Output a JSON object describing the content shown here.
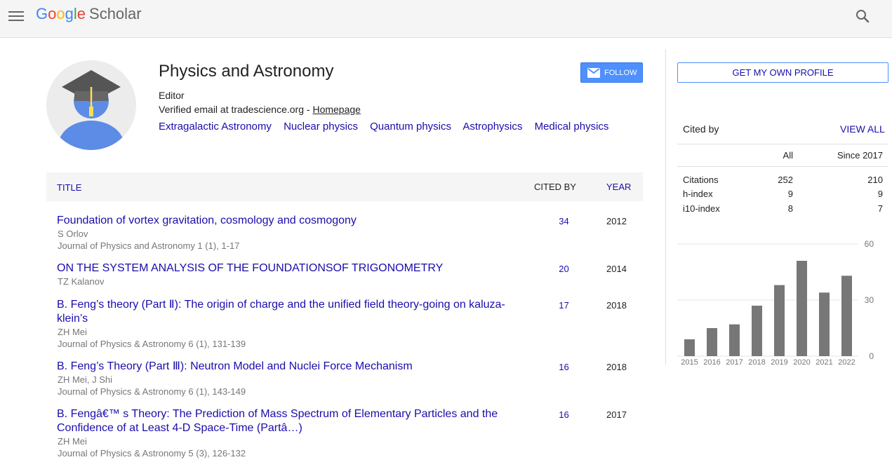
{
  "header": {
    "logo_letters": [
      "G",
      "o",
      "o",
      "g",
      "l",
      "e"
    ],
    "logo_suffix": "Scholar"
  },
  "profile": {
    "name": "Physics and Astronomy",
    "affiliation": "Editor",
    "email_text": "Verified email at tradescience.org - ",
    "homepage_label": "Homepage",
    "interests": [
      "Extragalactic Astronomy",
      "Nuclear physics",
      "Quantum physics",
      "Astrophysics",
      "Medical physics"
    ],
    "follow_label": "FOLLOW"
  },
  "table": {
    "headers": {
      "title": "TITLE",
      "cited_by": "CITED BY",
      "year": "YEAR"
    },
    "rows": [
      {
        "title": "Foundation of vortex gravitation, cosmology and cosmogony",
        "authors": "S Orlov",
        "venue": "Journal of Physics and Astronomy 1 (1), 1-17",
        "cited": "34",
        "year": "2012"
      },
      {
        "title": "ON THE SYSTEM ANALYSIS OF THE FOUNDATIONSOF TRIGONOMETRY",
        "authors": "TZ Kalanov",
        "venue": "",
        "cited": "20",
        "year": "2014"
      },
      {
        "title": "B. Feng’s theory (Part Ⅱ): The origin of charge and the unified field theory-going on kaluza-klein’s",
        "authors": "ZH Mei",
        "venue": "Journal of Physics & Astronomy 6 (1), 131-139",
        "cited": "17",
        "year": "2018"
      },
      {
        "title": "B. Feng’s Theory (Part Ⅲ): Neutron Model and Nuclei Force Mechanism",
        "authors": "ZH Mei, J Shi",
        "venue": "Journal of Physics & Astronomy 6 (1), 143-149",
        "cited": "16",
        "year": "2018"
      },
      {
        "title": "B. Fengâ€™ s Theory: The Prediction of Mass Spectrum of Elementary Particles and the Confidence of at Least 4-D Space-Time (Partâ…)",
        "authors": "ZH Mei",
        "venue": "Journal of Physics & Astronomy 5 (3), 126-132",
        "cited": "16",
        "year": "2017"
      }
    ]
  },
  "sidebar": {
    "get_profile_label": "GET MY OWN PROFILE",
    "cited_by_label": "Cited by",
    "view_all_label": "VIEW ALL",
    "col_all": "All",
    "col_since": "Since 2017",
    "stats": [
      {
        "label": "Citations",
        "all": "252",
        "since": "210"
      },
      {
        "label": "h-index",
        "all": "9",
        "since": "9"
      },
      {
        "label": "i10-index",
        "all": "8",
        "since": "7"
      }
    ]
  },
  "chart_data": {
    "type": "bar",
    "categories": [
      "2015",
      "2016",
      "2017",
      "2018",
      "2019",
      "2020",
      "2021",
      "2022"
    ],
    "values": [
      9,
      15,
      17,
      27,
      38,
      51,
      34,
      43
    ],
    "ylim": [
      0,
      60
    ],
    "yticks": [
      "0",
      "30",
      "60"
    ],
    "bar_color": "#777777"
  }
}
